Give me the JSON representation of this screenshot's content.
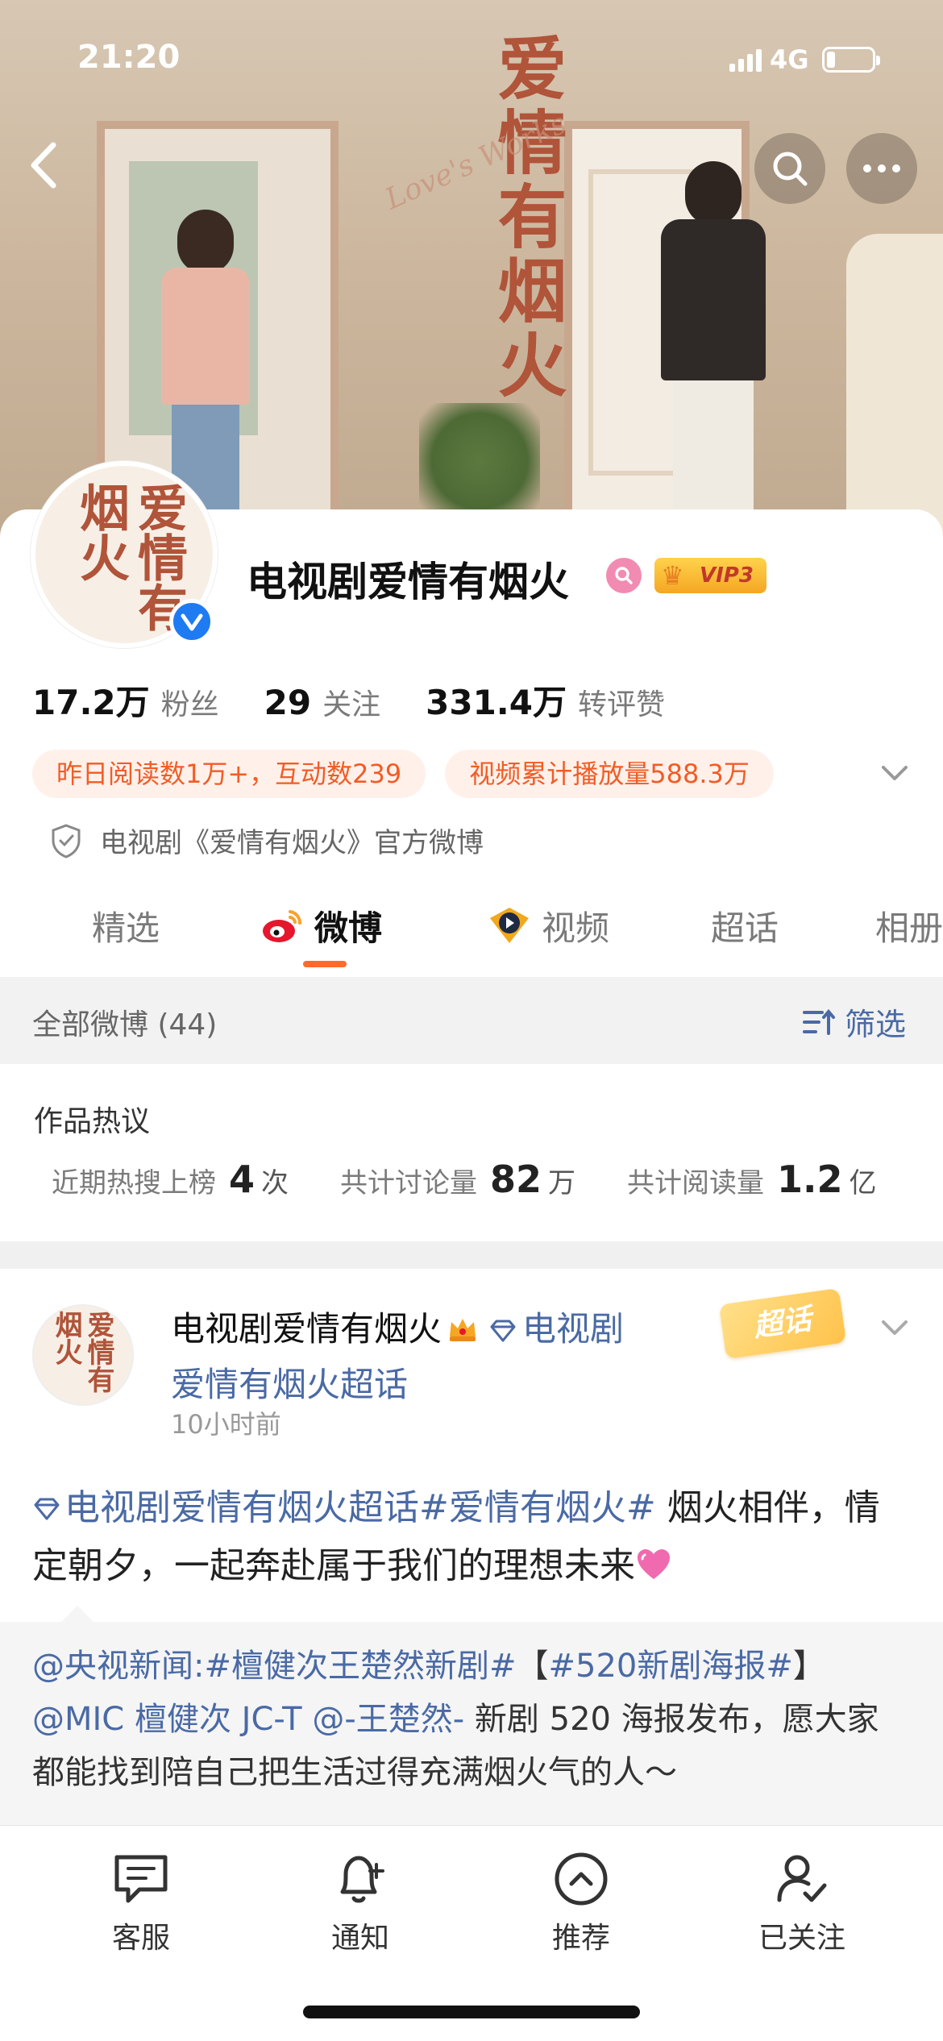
{
  "status_bar": {
    "time": "21:20",
    "network": "4G"
  },
  "banner": {
    "title": "爱情有烟火",
    "script_text": "Love's Works"
  },
  "profile": {
    "avatar_text": "爱情有烟火",
    "name": "电视剧爱情有烟火",
    "vip_label": "VIP3",
    "stats": [
      {
        "num": "17.2万",
        "label": "粉丝"
      },
      {
        "num": "29",
        "label": "关注"
      },
      {
        "num": "331.4万",
        "label": "转评赞"
      }
    ],
    "chips": [
      "昨日阅读数1万+，互动数239",
      "视频累计播放量588.3万"
    ],
    "official_text": "电视剧《爱情有烟火》官方微博"
  },
  "tabs": [
    {
      "label": "精选",
      "icon": ""
    },
    {
      "label": "微博",
      "icon": "weibo-icon"
    },
    {
      "label": "视频",
      "icon": "video-icon"
    },
    {
      "label": "超话",
      "icon": ""
    },
    {
      "label": "相册",
      "icon": ""
    }
  ],
  "filter": {
    "left": "全部微博 (44)",
    "right": "筛选"
  },
  "hot": {
    "title": "作品热议",
    "items": [
      {
        "label": "近期热搜上榜",
        "num": "4",
        "unit": "次"
      },
      {
        "label": "共计讨论量",
        "num": "82",
        "unit": "万"
      },
      {
        "label": "共计阅读量",
        "num": "1.2",
        "unit": "亿"
      }
    ]
  },
  "post": {
    "avatar_text": "爱情有烟火",
    "author": "电视剧爱情有烟火",
    "topic": "电视剧爱情有烟火超话",
    "time": "10小时前",
    "tag": "超话",
    "text_topic": "电视剧爱情有烟火超话",
    "text_hashtag": "#爱情有烟火#",
    "text_body": " 烟火相伴，情定朝夕，一起奔赴属于我们的理想未来",
    "repost": {
      "part1": "@央视新闻",
      "part2": ":",
      "part3": "#檀健次王楚然新剧#",
      "part4": "【",
      "part5": "#520新剧海报#",
      "part6": "】",
      "part7": "@MIC 檀健次 JC-T",
      "part8": " ",
      "part9": "@-王楚然-",
      "part10": " 新剧 520 海报发布，愿大家都能找到陪自己把生活过得充满烟火气的人～"
    }
  },
  "bottom_nav": [
    {
      "label": "客服",
      "icon": "chat-icon"
    },
    {
      "label": "通知",
      "icon": "bell-icon"
    },
    {
      "label": "推荐",
      "icon": "up-arrow-icon"
    },
    {
      "label": "已关注",
      "icon": "user-check-icon"
    }
  ],
  "colors": {
    "accent": "#ff6a2b",
    "link": "#4a6aa5",
    "chip_text": "#f25c26",
    "verify": "#1f7bf2"
  }
}
